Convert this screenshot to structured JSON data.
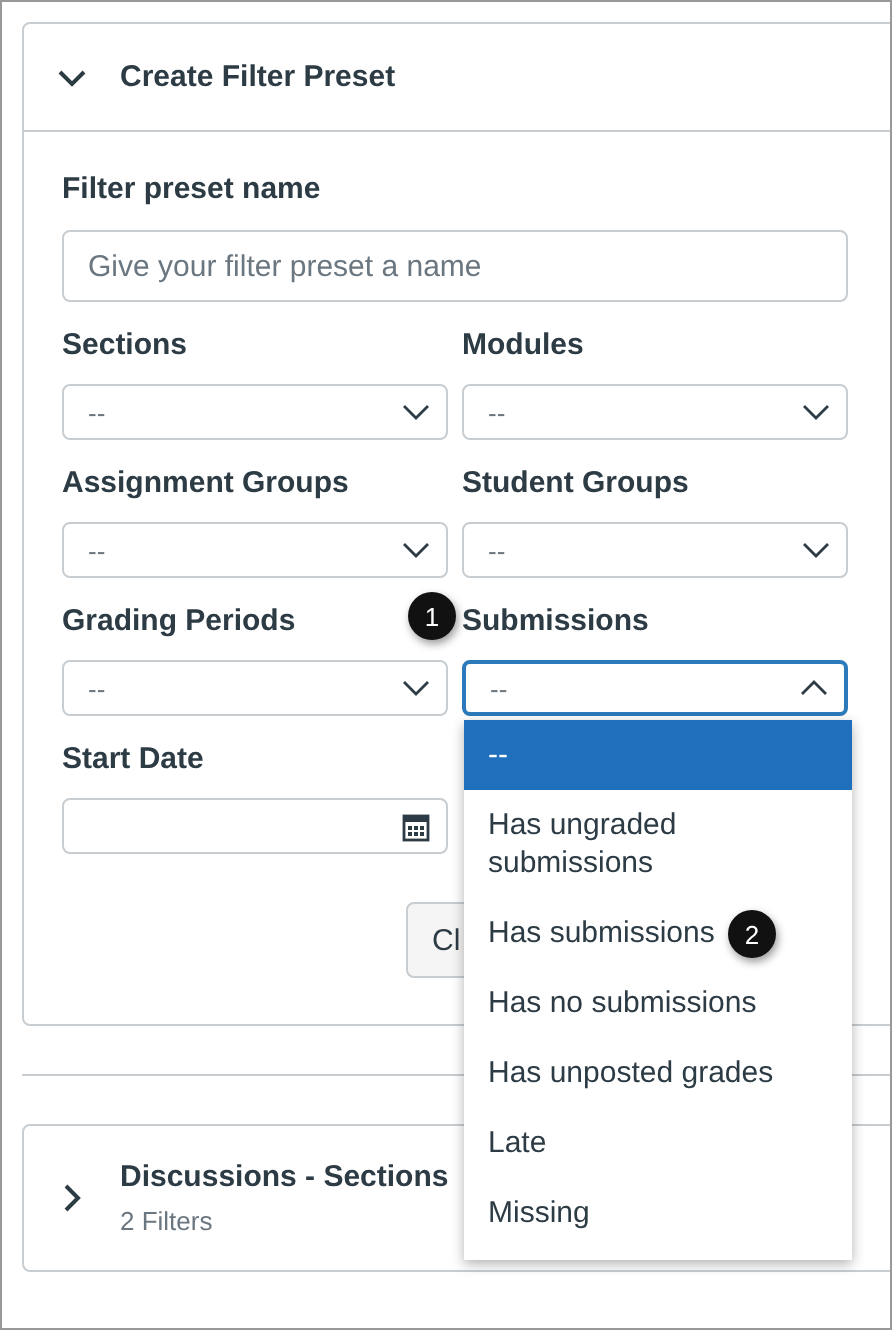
{
  "panel": {
    "title": "Create Filter Preset",
    "expanded": true
  },
  "name_field": {
    "label": "Filter preset name",
    "placeholder": "Give your filter preset a name"
  },
  "selects": [
    {
      "label": "Sections",
      "value": "--",
      "open": false
    },
    {
      "label": "Modules",
      "value": "--",
      "open": false
    },
    {
      "label": "Assignment Groups",
      "value": "--",
      "open": false
    },
    {
      "label": "Student Groups",
      "value": "--",
      "open": false
    },
    {
      "label": "Grading Periods",
      "value": "--",
      "open": false
    },
    {
      "label": "Submissions",
      "value": "--",
      "open": true
    }
  ],
  "start_date": {
    "label": "Start Date"
  },
  "button": "Cl",
  "dropdown": {
    "options": [
      {
        "label": "--",
        "selected": true
      },
      {
        "label": "Has ungraded submissions",
        "selected": false
      },
      {
        "label": "Has submissions",
        "selected": false
      },
      {
        "label": "Has no submissions",
        "selected": false
      },
      {
        "label": "Has unposted grades",
        "selected": false
      },
      {
        "label": "Late",
        "selected": false
      },
      {
        "label": "Missing",
        "selected": false
      }
    ]
  },
  "callouts": [
    "1",
    "2"
  ],
  "presets": [
    {
      "title": "Discussions - Sections",
      "subtitle": "2 Filters",
      "expanded": false
    }
  ]
}
